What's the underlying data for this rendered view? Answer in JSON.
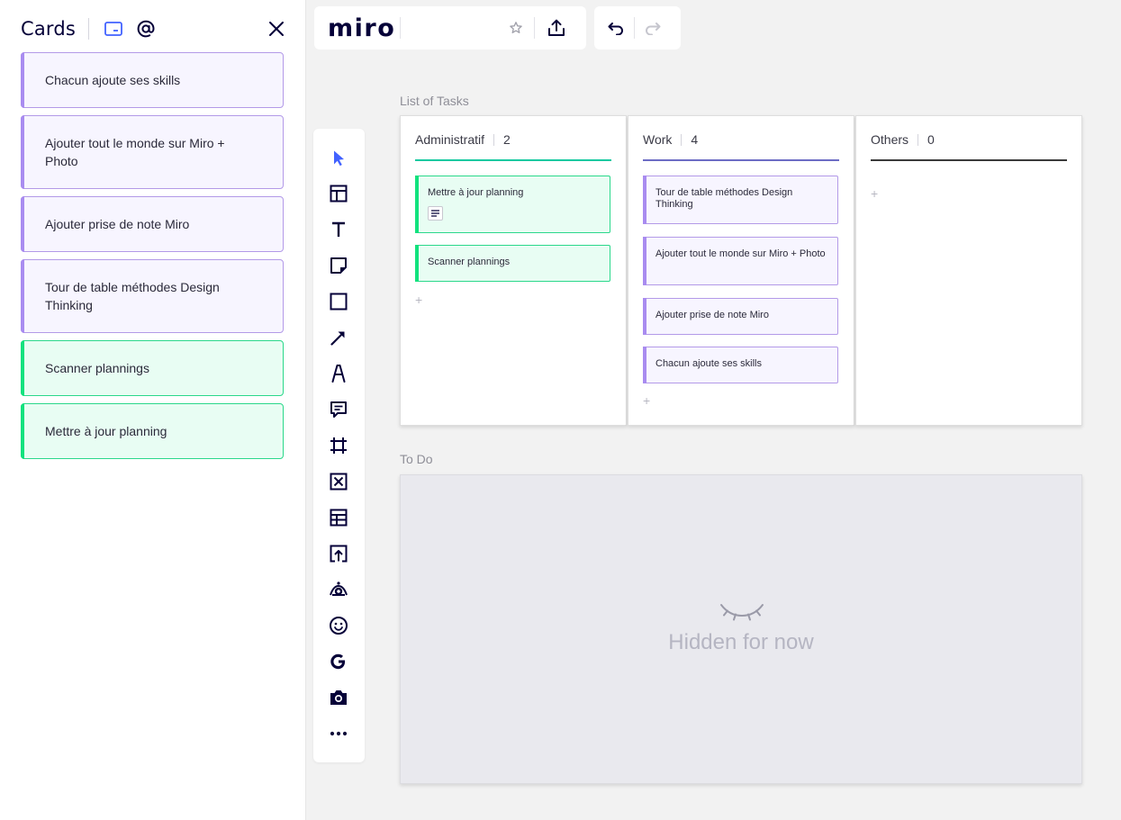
{
  "sidebar": {
    "title": "Cards",
    "cards": [
      {
        "text": "Chacun ajoute ses skills",
        "color": "purple"
      },
      {
        "text": "Ajouter tout le monde sur Miro + Photo",
        "color": "purple"
      },
      {
        "text": "Ajouter prise de note Miro",
        "color": "purple"
      },
      {
        "text": "Tour de table méthodes Design Thinking",
        "color": "purple"
      },
      {
        "text": "Scanner plannings",
        "color": "green"
      },
      {
        "text": "Mettre à jour planning",
        "color": "green"
      }
    ]
  },
  "topbar": {
    "logo": "miro"
  },
  "toolbar": {
    "tools": [
      "select-icon",
      "templates-icon",
      "text-icon",
      "sticky-note-icon",
      "shape-icon",
      "connection-line-icon",
      "pen-icon",
      "comment-icon",
      "frame-icon",
      "card-icon",
      "table-icon",
      "upload-icon",
      "mind-map-icon",
      "emoji-icon",
      "google-icon",
      "camera-icon",
      "more-icon"
    ]
  },
  "board": {
    "kanban_title": "List of Tasks",
    "columns": [
      {
        "name": "Administratif",
        "count": "2",
        "line_color": "#14c9a0",
        "cards": [
          "Mettre à jour planning",
          "Scanner plannings"
        ]
      },
      {
        "name": "Work",
        "count": "4",
        "line_color": "#6c6cc4",
        "cards": [
          "Tour de table méthodes Design Thinking",
          "Ajouter tout le monde sur Miro + Photo",
          "Ajouter prise de note Miro",
          "Chacun ajoute ses skills"
        ]
      },
      {
        "name": "Others",
        "count": "0",
        "line_color": "#3a3a3a",
        "cards": []
      }
    ],
    "add_symbol": "+",
    "todo_title": "To Do",
    "hidden_text": "Hidden for now"
  },
  "colors": {
    "accent_purple": "#a98cf0",
    "accent_green": "#12e27e",
    "select_blue": "#4262ff"
  }
}
